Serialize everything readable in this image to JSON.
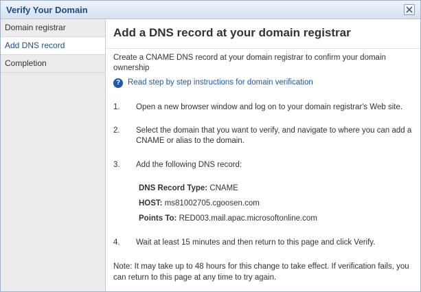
{
  "window": {
    "title": "Verify Your Domain"
  },
  "sidebar": {
    "items": [
      {
        "label": "Domain registrar"
      },
      {
        "label": "Add DNS record"
      },
      {
        "label": "Completion"
      }
    ]
  },
  "main": {
    "heading": "Add a DNS record at your domain registrar",
    "intro": "Create a CNAME DNS record at your domain registrar to confirm your domain ownership",
    "help_link": "Read step by step instructions for domain verification",
    "steps": [
      {
        "num": "1.",
        "text": "Open a new browser window and log on to your domain registrar's Web site."
      },
      {
        "num": "2.",
        "text": "Select the domain that you want to verify, and navigate to where you can add a CNAME or alias to the domain."
      },
      {
        "num": "3.",
        "text": "Add the following DNS record:"
      },
      {
        "num": "4.",
        "text": "Wait at least 15 minutes and then return to this page and click Verify."
      }
    ],
    "record": {
      "type_label": "DNS Record Type:",
      "type_value": "CNAME",
      "host_label": "HOST:",
      "host_value": "ms81002705.cgoosen.com",
      "points_label": "Points To:",
      "points_value": "RED003.mail.apac.microsoftonline.com"
    },
    "note": "Note: It may take up to 48 hours for this change to take effect. If verification fails, you can return to this page at any time to try again."
  },
  "colors": {
    "accent": "#1c4a8a",
    "link": "#1c5aa6",
    "sidebar_bg": "#ececec"
  }
}
